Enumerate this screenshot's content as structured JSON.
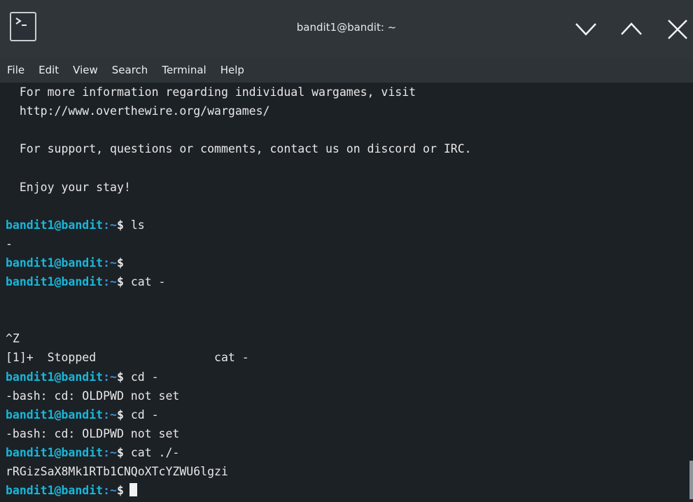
{
  "window": {
    "title": "bandit1@bandit: ~",
    "icon": "terminal-icon",
    "controls": [
      "minimize-icon",
      "maximize-icon",
      "close-icon"
    ]
  },
  "menu": [
    "File",
    "Edit",
    "View",
    "Search",
    "Terminal",
    "Help"
  ],
  "prompt": {
    "user": "bandit1@bandit",
    "path": ":~",
    "symbol": "$"
  },
  "terminal_lines": [
    "  For more information regarding individual wargames, visit",
    "  http://www.overthewire.org/wargames/",
    "",
    "  For support, questions or comments, contact us on discord or IRC.",
    "",
    "  Enjoy your stay!",
    "",
    {
      "cmd": " ls"
    },
    "-",
    {
      "cmd": ""
    },
    {
      "cmd": " cat -"
    },
    "",
    "",
    "^Z",
    "[1]+  Stopped                 cat -",
    {
      "cmd": " cd -"
    },
    "-bash: cd: OLDPWD not set",
    {
      "cmd": " cd -"
    },
    "-bash: cd: OLDPWD not set",
    {
      "cmd": " cat ./-"
    },
    "rRGizSaX8Mk1RTb1CNQoXTcYZWU6lgzi",
    {
      "cmd": "",
      "cursor": true
    }
  ],
  "colors": {
    "background": "#1c2126",
    "titlebar": "#30353a",
    "prompt_user": "#19b7d9",
    "prompt_path": "#3d8fd3",
    "text": "#e8e8e8"
  }
}
